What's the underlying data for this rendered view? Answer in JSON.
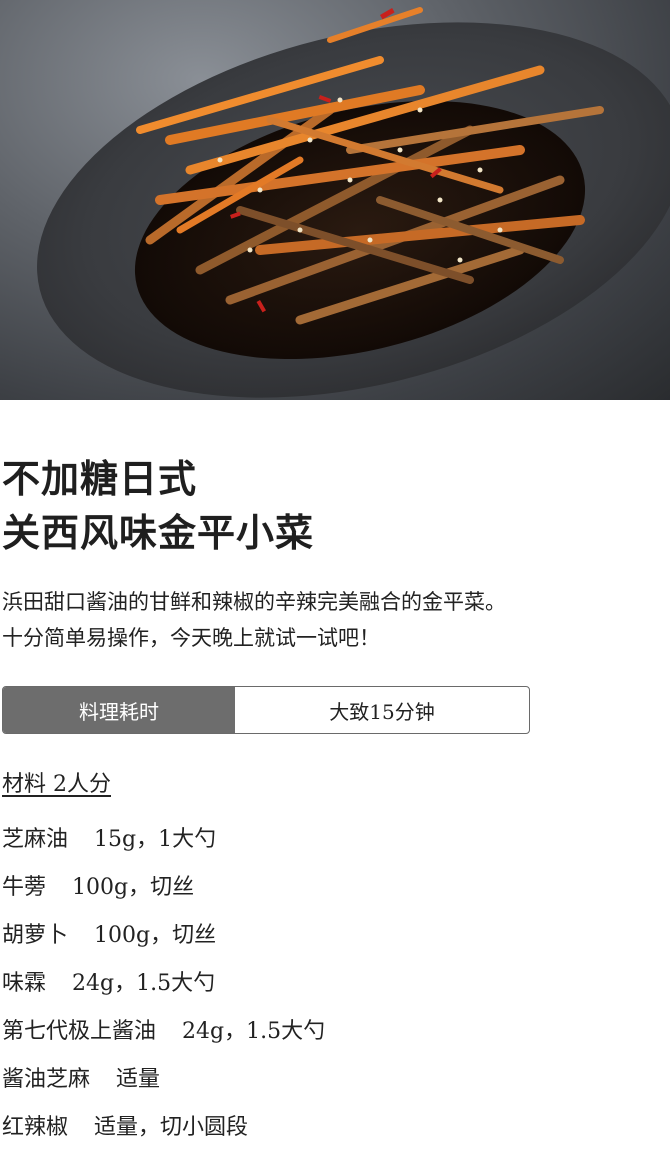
{
  "hero": {
    "image": "kinpira-dish-photo"
  },
  "title": {
    "line1": "不加糖日式",
    "line2": "关西风味金平小菜"
  },
  "description": {
    "line1": "浜田甜口酱油的甘鲜和辣椒的辛辣完美融合的金平菜。",
    "line2": "十分简单易操作，今天晚上就试一试吧！"
  },
  "cook_time": {
    "label": "料理耗时",
    "value": "大致15分钟"
  },
  "ingredients": {
    "heading": "材料 2人分",
    "items": [
      {
        "name": "芝麻油",
        "amount": "15g，1大勺"
      },
      {
        "name": "牛蒡",
        "amount": "100g，切丝"
      },
      {
        "name": "胡萝卜",
        "amount": "100g，切丝"
      },
      {
        "name": "味霖",
        "amount": "24g，1.5大勺"
      },
      {
        "name": "第七代极上酱油",
        "amount": "24g，1.5大勺"
      },
      {
        "name": "酱油芝麻",
        "amount": "适量"
      },
      {
        "name": "红辣椒",
        "amount": "适量，切小圆段"
      }
    ]
  },
  "colors": {
    "time_label_bg": "#6d6d6d",
    "border": "#6a6a6a",
    "text": "#222222"
  }
}
